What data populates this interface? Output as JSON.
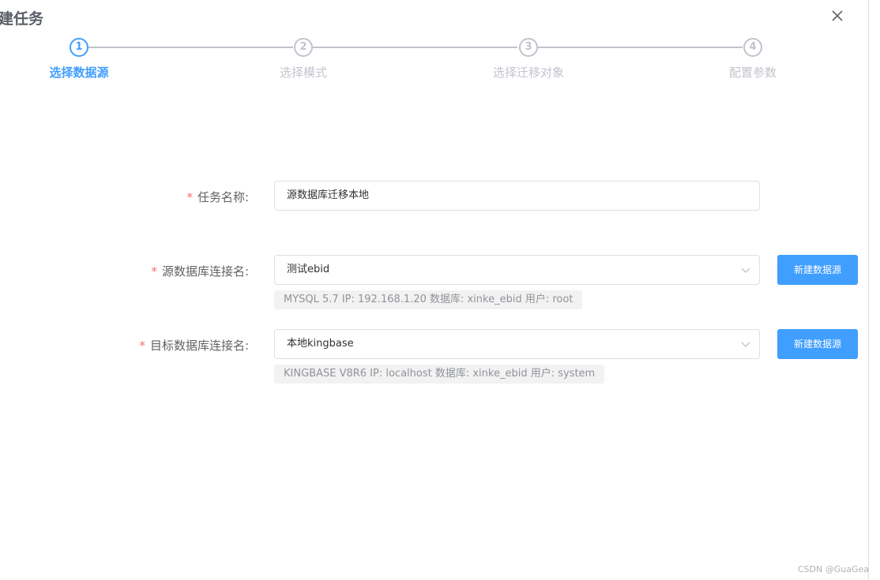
{
  "dialog": {
    "title": "建任务"
  },
  "steps": [
    {
      "number": "1",
      "label": "选择数据源",
      "active": true
    },
    {
      "number": "2",
      "label": "选择模式",
      "active": false
    },
    {
      "number": "3",
      "label": "选择迁移对象",
      "active": false
    },
    {
      "number": "4",
      "label": "配置参数",
      "active": false
    }
  ],
  "form": {
    "task_name": {
      "required_mark": "*",
      "label": "任务名称:",
      "value": "源数据库迁移本地"
    },
    "source": {
      "required_mark": "*",
      "label": "源数据库连接名:",
      "value": "测试ebid",
      "button": "新建数据源",
      "hint": "MYSQL 5.7 IP: 192.168.1.20 数据库: xinke_ebid 用户: root"
    },
    "target": {
      "required_mark": "*",
      "label": "目标数据库连接名:",
      "value": "本地kingbase",
      "button": "新建数据源",
      "hint": "KINGBASE V8R6 IP: localhost 数据库: xinke_ebid 用户: system"
    }
  },
  "watermark": "CSDN @GuaGea",
  "colors": {
    "primary": "#409eff",
    "required": "#f56c6c",
    "inactive": "#c0c4cc"
  },
  "icons": {
    "close": "close-icon",
    "select_arrow": "chevron-down-icon"
  }
}
